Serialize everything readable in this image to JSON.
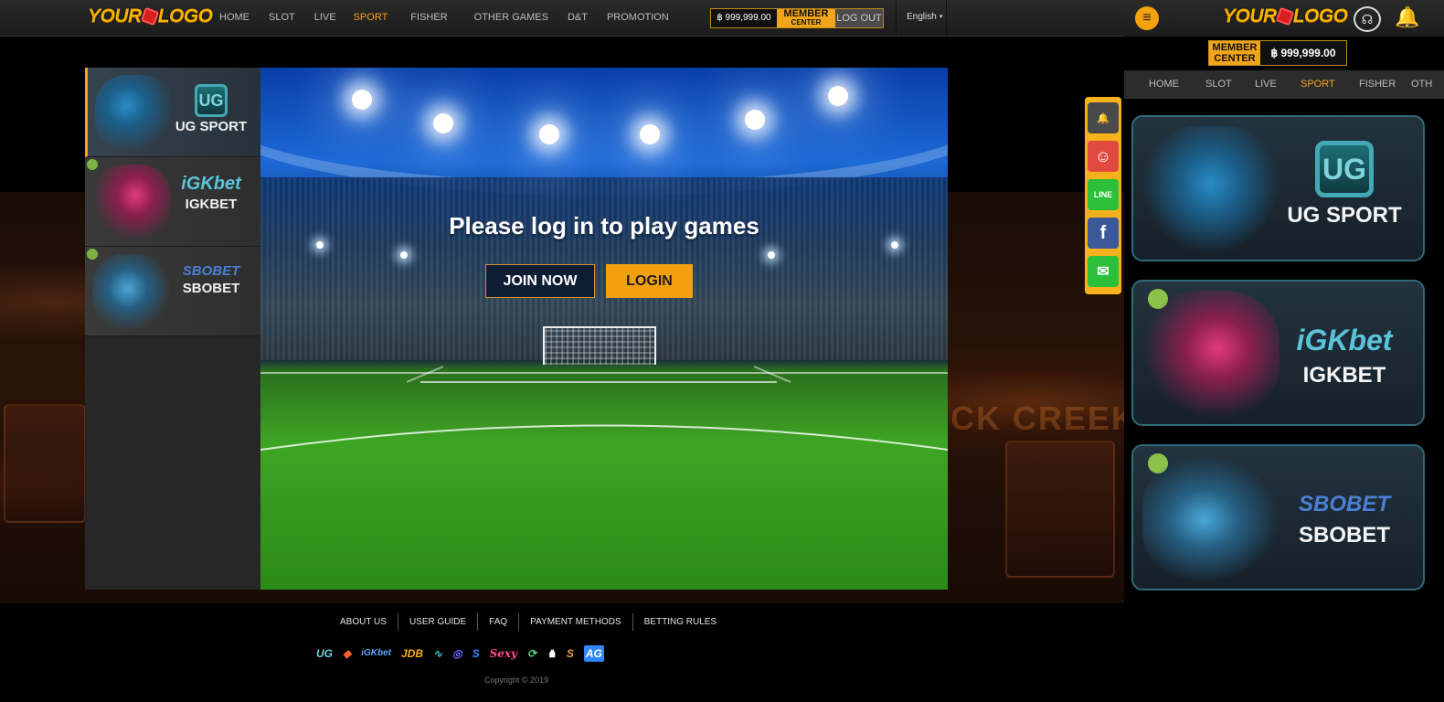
{
  "site": {
    "logo_text_left": "YOUR",
    "logo_text_right": "LOGO"
  },
  "nav": {
    "items": [
      {
        "label": "HOME",
        "active": false
      },
      {
        "label": "SLOT",
        "active": false
      },
      {
        "label": "LIVE",
        "active": false
      },
      {
        "label": "SPORT",
        "active": true
      },
      {
        "label": "FISHER",
        "active": false
      },
      {
        "label": "OTHER GAMES",
        "active": false
      },
      {
        "label": "D&T",
        "active": false
      },
      {
        "label": "PROMOTION",
        "active": false
      }
    ]
  },
  "account": {
    "balance": "฿ 999,999.00",
    "member_line1": "MEMBER",
    "member_line2": "CENTER",
    "logout_label": "LOG OUT"
  },
  "language": {
    "selected": "English",
    "caret": "▾"
  },
  "sidebar": {
    "providers": [
      {
        "label": "UG SPORT",
        "mark": "UG",
        "active": true
      },
      {
        "label": "IGKBET",
        "mark": "iGKbet",
        "active": false
      },
      {
        "label": "SBOBET",
        "mark": "SBOBET",
        "active": false
      }
    ]
  },
  "main": {
    "prompt": "Please log in to play games",
    "join_label": "JOIN NOW",
    "login_label": "LOGIN"
  },
  "footer": {
    "links": [
      "ABOUT US",
      "USER GUIDE",
      "FAQ",
      "PAYMENT METHODS",
      "BETTING RULES"
    ],
    "provider_logos": [
      {
        "text": "UG",
        "color": "#6fd0dc"
      },
      {
        "text": "◆",
        "color": "#f2612c"
      },
      {
        "text": "iGKbet",
        "color": "#5aa7ff"
      },
      {
        "text": "JDB",
        "color": "#f5b21a"
      },
      {
        "text": "∿",
        "color": "#33c5d1"
      },
      {
        "text": "◎",
        "color": "#6a6cff"
      },
      {
        "text": "S",
        "color": "#3f86ff"
      },
      {
        "text": "Sexy",
        "color": "#ff4b8b"
      },
      {
        "text": "⟳",
        "color": "#4ad07a"
      },
      {
        "text": "♞",
        "color": "#ffffff"
      },
      {
        "text": "S",
        "color": "#e2a052"
      },
      {
        "text": "AG",
        "color": "#2f86ff"
      }
    ],
    "copyright": "Copyright © 2019"
  },
  "contact_bar": {
    "buttons": [
      {
        "name": "notification",
        "glyph": "🔔",
        "color": "#4a4a4a"
      },
      {
        "name": "support",
        "glyph": "☺",
        "color": "#e04a3f"
      },
      {
        "name": "line",
        "glyph": "LINE",
        "color": "#2bbf3a"
      },
      {
        "name": "facebook",
        "glyph": "f",
        "color": "#3b5998"
      },
      {
        "name": "wechat",
        "glyph": "✉",
        "color": "#2bbf3a"
      }
    ]
  },
  "mobile": {
    "menu_glyph": "≡",
    "support_glyph": "☊",
    "bell_glyph": "🔔",
    "balance": "฿ 999,999.00",
    "member_line1": "MEMBER",
    "member_line2": "CENTER",
    "nav": [
      {
        "label": "HOME",
        "active": false
      },
      {
        "label": "SLOT",
        "active": false
      },
      {
        "label": "LIVE",
        "active": false
      },
      {
        "label": "SPORT",
        "active": true
      },
      {
        "label": "FISHER",
        "active": false
      },
      {
        "label": "OTH",
        "active": false
      }
    ],
    "cards": [
      {
        "label": "UG SPORT",
        "mark": "UG"
      },
      {
        "label": "IGKBET",
        "mark": "iGKbet"
      },
      {
        "label": "SBOBET",
        "mark": "SBOBET"
      }
    ]
  },
  "background": {
    "sign_text": "CK CREEK"
  },
  "colors": {
    "accent": "#f7a21b",
    "button_login": "#f3a00f"
  }
}
